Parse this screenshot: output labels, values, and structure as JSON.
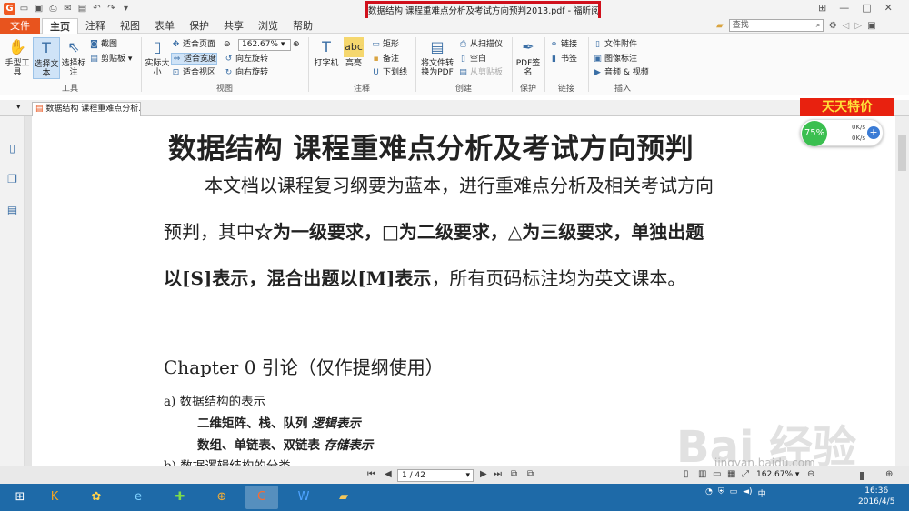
{
  "window": {
    "title": "数据结构 课程重难点分析及考试方向预判2013.pdf - 福昕阅读器"
  },
  "quick_access": [
    "foxit-logo-icon",
    "open-icon",
    "save-icon",
    "print-icon",
    "email-icon",
    "pdf-icon",
    "undo-icon",
    "redo-icon",
    "save-as-icon"
  ],
  "menu": {
    "file": "文件",
    "items": [
      "主页",
      "注释",
      "视图",
      "表单",
      "保护",
      "共享",
      "浏览",
      "帮助"
    ],
    "active": "主页"
  },
  "search": {
    "placeholder": "查找"
  },
  "ribbon": {
    "tools": {
      "hand": "手型工具",
      "select_text": "选择文本",
      "select_annot": "选择标注",
      "snapshot": "截图",
      "clipboard": "剪贴板",
      "label": "工具"
    },
    "view": {
      "actual_size": "实际大小",
      "fit_page": "适合页面",
      "fit_width": "适合宽度",
      "fit_visible": "适合视区",
      "zoom": "162.67%",
      "rotate_left": "向左旋转",
      "rotate_right": "向右旋转",
      "label": "视图"
    },
    "comment": {
      "typewriter": "打字机",
      "highlight": "高亮",
      "rect": "矩形",
      "note": "备注",
      "underline": "下划线",
      "label": "注释"
    },
    "create": {
      "convert": "将文件转换为PDF",
      "from_scanner": "从扫描仪",
      "blank": "空白",
      "from_clipboard": "从剪贴板",
      "label": "创建"
    },
    "protect": {
      "sign": "PDF签名",
      "label": "保护"
    },
    "links": {
      "link": "链接",
      "bookmark": "书签",
      "label": "链接"
    },
    "insert": {
      "attachment": "文件附件",
      "image": "图像标注",
      "audio": "音频 & 视频",
      "label": "插入"
    }
  },
  "ad": {
    "text": "天天特价"
  },
  "tab": {
    "title": "数据结构 课程重难点分析..."
  },
  "speed_widget": {
    "percent": "75%",
    "up": "0K/s",
    "down": "0K/s"
  },
  "document": {
    "title": "数据结构  课程重难点分析及考试方向预判",
    "p1": "本文档以课程复习纲要为蓝本，进行重难点分析及相关考试方向",
    "p2_a": "预判，其中",
    "p2_b": "☆为一级要求，□为二级要求，△为三级要求，单独出题",
    "p3_a": "以[S]表示，混合出题以[M]表示",
    "p3_b": "，所有页码标注均为英文课本。",
    "chapter": "Chapter 0  引论（仅作提纲使用）",
    "item_a": "a)    数据结构的表示",
    "line1_a": "二维矩阵、栈、队列",
    "line1_b": "逻辑表示",
    "line2_a": "数组、单链表、双链表",
    "line2_b": "存储表示",
    "item_b": "b)    数据逻辑结构的分类"
  },
  "status": {
    "page": "1 / 42",
    "zoom": "162.67%"
  },
  "watermark": {
    "brand": "Bai 经验",
    "url": "jingyan.baidu.com"
  },
  "clock": {
    "time": "16:36",
    "date": "2016/4/5"
  },
  "tray": {
    "ime": "中"
  }
}
